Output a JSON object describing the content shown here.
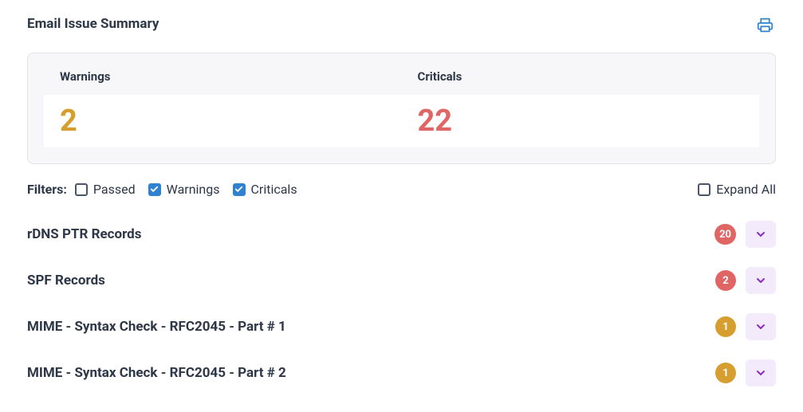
{
  "header": {
    "title": "Email Issue Summary"
  },
  "summary": {
    "warnings_label": "Warnings",
    "criticals_label": "Criticals",
    "warnings": "2",
    "criticals": "22"
  },
  "filters": {
    "label": "Filters:",
    "passed_label": "Passed",
    "warnings_label": "Warnings",
    "criticals_label": "Criticals",
    "expand_all_label": "Expand All",
    "passed_checked": false,
    "warnings_checked": true,
    "criticals_checked": true,
    "expand_all_checked": false
  },
  "issues": [
    {
      "title": "rDNS PTR Records",
      "count": "20",
      "severity": "crit"
    },
    {
      "title": "SPF Records",
      "count": "2",
      "severity": "crit"
    },
    {
      "title": "MIME - Syntax Check - RFC2045 - Part # 1",
      "count": "1",
      "severity": "warn"
    },
    {
      "title": "MIME - Syntax Check - RFC2045 - Part # 2",
      "count": "1",
      "severity": "warn"
    }
  ]
}
